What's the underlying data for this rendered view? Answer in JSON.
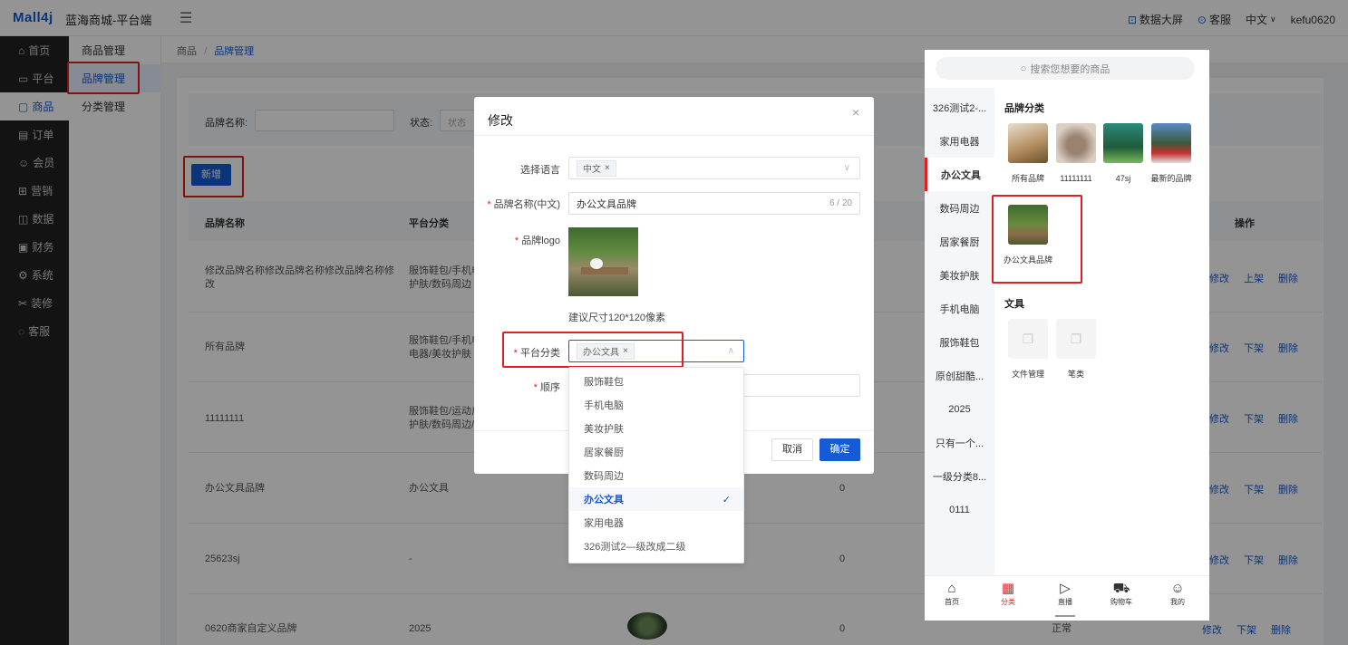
{
  "topbar": {
    "logo": "Mall4j",
    "app_name": "蓝海商城-平台端",
    "collapse": "☰",
    "dashboard": "数据大屏",
    "service": "客服",
    "language": "中文",
    "user": "kefu0620"
  },
  "sidebar": {
    "items": [
      {
        "icon": "⌂",
        "label": "首页"
      },
      {
        "icon": "▭",
        "label": "平台"
      },
      {
        "icon": "▢",
        "label": "商品"
      },
      {
        "icon": "▤",
        "label": "订单"
      },
      {
        "icon": "☺",
        "label": "会员"
      },
      {
        "icon": "⊞",
        "label": "营销"
      },
      {
        "icon": "◫",
        "label": "数据"
      },
      {
        "icon": "▣",
        "label": "财务"
      },
      {
        "icon": "⚙",
        "label": "系统"
      },
      {
        "icon": "✂",
        "label": "装修"
      },
      {
        "icon": "◌",
        "label": "客服"
      }
    ]
  },
  "submenu": {
    "items": [
      "商品管理",
      "品牌管理",
      "分类管理"
    ]
  },
  "breadcrumb": {
    "root": "商品",
    "sep": "/",
    "current": "品牌管理"
  },
  "search": {
    "brand_label": "品牌名称:",
    "status_label": "状态:",
    "status_placeholder": "状态"
  },
  "add_button": "新增",
  "table": {
    "headers": {
      "name": "品牌名称",
      "category": "平台分类",
      "ops": "操作"
    },
    "rows": [
      {
        "name": "修改品牌名称修改品牌名称修改品牌名称修改",
        "category": "服饰鞋包/手机电脑/美妆护肤/数码周边",
        "sort": "",
        "status": "",
        "ops": [
          "修改",
          "上架",
          "删除"
        ]
      },
      {
        "name": "所有品牌",
        "category": "服饰鞋包/手机电脑/家用电器/美妆护肤",
        "sort": "",
        "status": "",
        "ops": [
          "修改",
          "下架",
          "删除"
        ]
      },
      {
        "name": "11111111",
        "category": "服饰鞋包/运动户外/美妆护肤/数码周边/办公文具",
        "sort": "",
        "status": "",
        "ops": [
          "修改",
          "下架",
          "删除"
        ]
      },
      {
        "name": "办公文具品牌",
        "category": "办公文具",
        "sort": "0",
        "status": "",
        "ops": [
          "修改",
          "下架",
          "删除"
        ]
      },
      {
        "name": "25623sj",
        "category": "-",
        "sort": "0",
        "status": "",
        "ops": [
          "修改",
          "下架",
          "删除"
        ]
      },
      {
        "name": "0620商家自定义品牌",
        "category": "2025",
        "sort": "0",
        "status": "正常",
        "ops": [
          "修改",
          "下架",
          "删除"
        ]
      }
    ]
  },
  "dialog": {
    "title": "修改",
    "close": "×",
    "lang_label": "选择语言",
    "lang_tag": "中文",
    "name_label": "品牌名称(中文)",
    "name_value": "办公文具品牌",
    "name_count": "6 / 20",
    "logo_label": "品牌logo",
    "logo_hint": "建议尺寸120*120像素",
    "category_label": "平台分类",
    "category_tag": "办公文具",
    "sort_label": "顺序",
    "cancel": "取消",
    "confirm": "确定"
  },
  "dropdown": {
    "options": [
      "服饰鞋包",
      "手机电脑",
      "美妆护肤",
      "居家餐厨",
      "数码周边",
      "办公文具",
      "家用电器",
      "326测试2—级改成二级"
    ],
    "selected_index": 5,
    "check": "✓"
  },
  "phone": {
    "search_placeholder": "搜索您想要的商品",
    "categories": [
      "326测试2-...",
      "家用电器",
      "办公文具",
      "数码周边",
      "居家餐厨",
      "美妆护肤",
      "手机电脑",
      "服饰鞋包",
      "原创甜酷...",
      "2025",
      "只有一个...",
      "一级分类8...",
      "0111"
    ],
    "active_category_index": 2,
    "brand_section": "品牌分类",
    "brands": [
      "所有品牌",
      "11111111",
      "47sj",
      "最新的品牌"
    ],
    "highlight_brand": "办公文具品牌",
    "sub_section": "文具",
    "sub_items": [
      "文件管理",
      "笔类"
    ],
    "tabs": [
      "首页",
      "分类",
      "直播",
      "购物车",
      "我的"
    ],
    "active_tab": 1
  }
}
